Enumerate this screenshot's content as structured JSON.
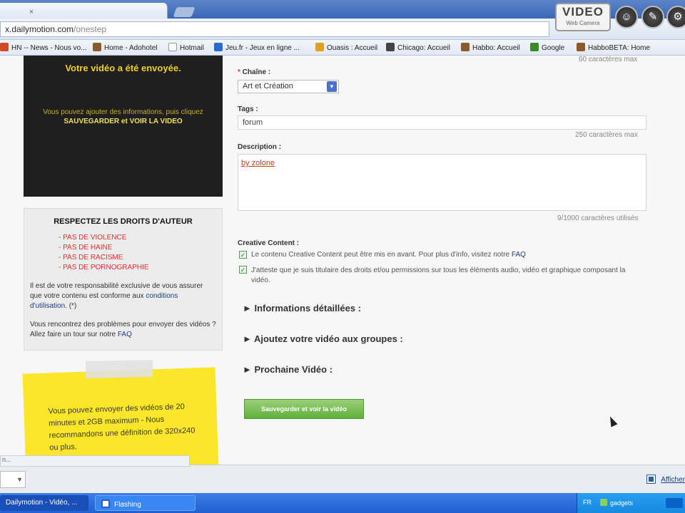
{
  "browser": {
    "tab_close_glyph": "×",
    "url_domain": "x.dailymotion.com",
    "url_path": "/onestep"
  },
  "overlay": {
    "logo_big": "VIDEO",
    "logo_small": "Web Camera",
    "buttons": [
      "person-icon",
      "edit-icon",
      "settings-icon"
    ]
  },
  "bookmarks": [
    {
      "label": "HN -- News - Nous vo...",
      "color": "#d04a2a"
    },
    {
      "label": "Home - Adohotel",
      "color": "#8a5a2a"
    },
    {
      "label": "Hotmail",
      "color": "#ffffff"
    },
    {
      "label": "Jeu.fr - Jeux en ligne ...",
      "color": "#2a6ad0"
    },
    {
      "label": "Ouasis : Accueil",
      "color": "#e0a020"
    },
    {
      "label": "Chicago: Accueil",
      "color": "#444444"
    },
    {
      "label": "Habbo: Accueil",
      "color": "#8a5a2a"
    },
    {
      "label": "Google",
      "color": "#3a8a2a"
    },
    {
      "label": "HabboBETA: Home",
      "color": "#8a5a2a"
    }
  ],
  "upload_box": {
    "title": "Votre vidéo a été envoyée.",
    "line1": "Vous pouvez ajouter des informations, puis cliquez",
    "line2": "SAUVEGARDER et VOIR LA VIDEO"
  },
  "copyright": {
    "heading": "RESPECTEZ LES DROITS D'AUTEUR",
    "items": [
      "- PAS DE VIOLENCE",
      "- PAS DE HAINE",
      "- PAS DE RACISME",
      "- PAS DE PORNOGRAPHIE"
    ],
    "para1": "Il est de votre responsabilité exclusive de vous assurer que votre contenu est conforme aux",
    "link1": "conditions d'utilisation.",
    "para1_end": " (*)",
    "para2": "Vous rencontrez des problèmes pour envoyer des vidéos ? Allez faire un tour sur notre ",
    "link2": "FAQ"
  },
  "sticky": {
    "text": "Vous pouvez envoyer des vidéos de 20 minutes et 2GB maximum - Nous recommandons une définition de 320x240 ou plus."
  },
  "form": {
    "title_hint": "60 caractères max",
    "channel_label": "Chaîne :",
    "channel_value": "Art et Création",
    "tags_label": "Tags :",
    "tags_value": "forum",
    "tags_hint": "250 caractères max",
    "description_label": "Description :",
    "description_value": "by zolone",
    "description_hint": "9/1000 caractères utilisés",
    "cc_label": "Creative Content :",
    "cc_option1": "Le contenu Creative Content peut être mis en avant. Pour plus d'info, visitez notre ",
    "cc_option1_link": "FAQ",
    "cc_option2": "J'atteste que je suis titulaire des droits et/ou permissions sur tous les éléments audio, vidéo et graphique composant la vidéo.",
    "sections": [
      "► Informations détaillées :",
      "► Ajoutez votre vidéo aux groupes :",
      "► Prochaine Vidéo :"
    ],
    "save_button": "Sauvegarder et voir la vidéo"
  },
  "statusbar": {
    "tip": "n...",
    "box_text": "▼",
    "show_all": "Afficher"
  },
  "taskbar": {
    "task1": "Dailymotion - Vidéo, ...",
    "task2": "Flashing",
    "lang": "FR",
    "gadgets": "gadgets"
  }
}
